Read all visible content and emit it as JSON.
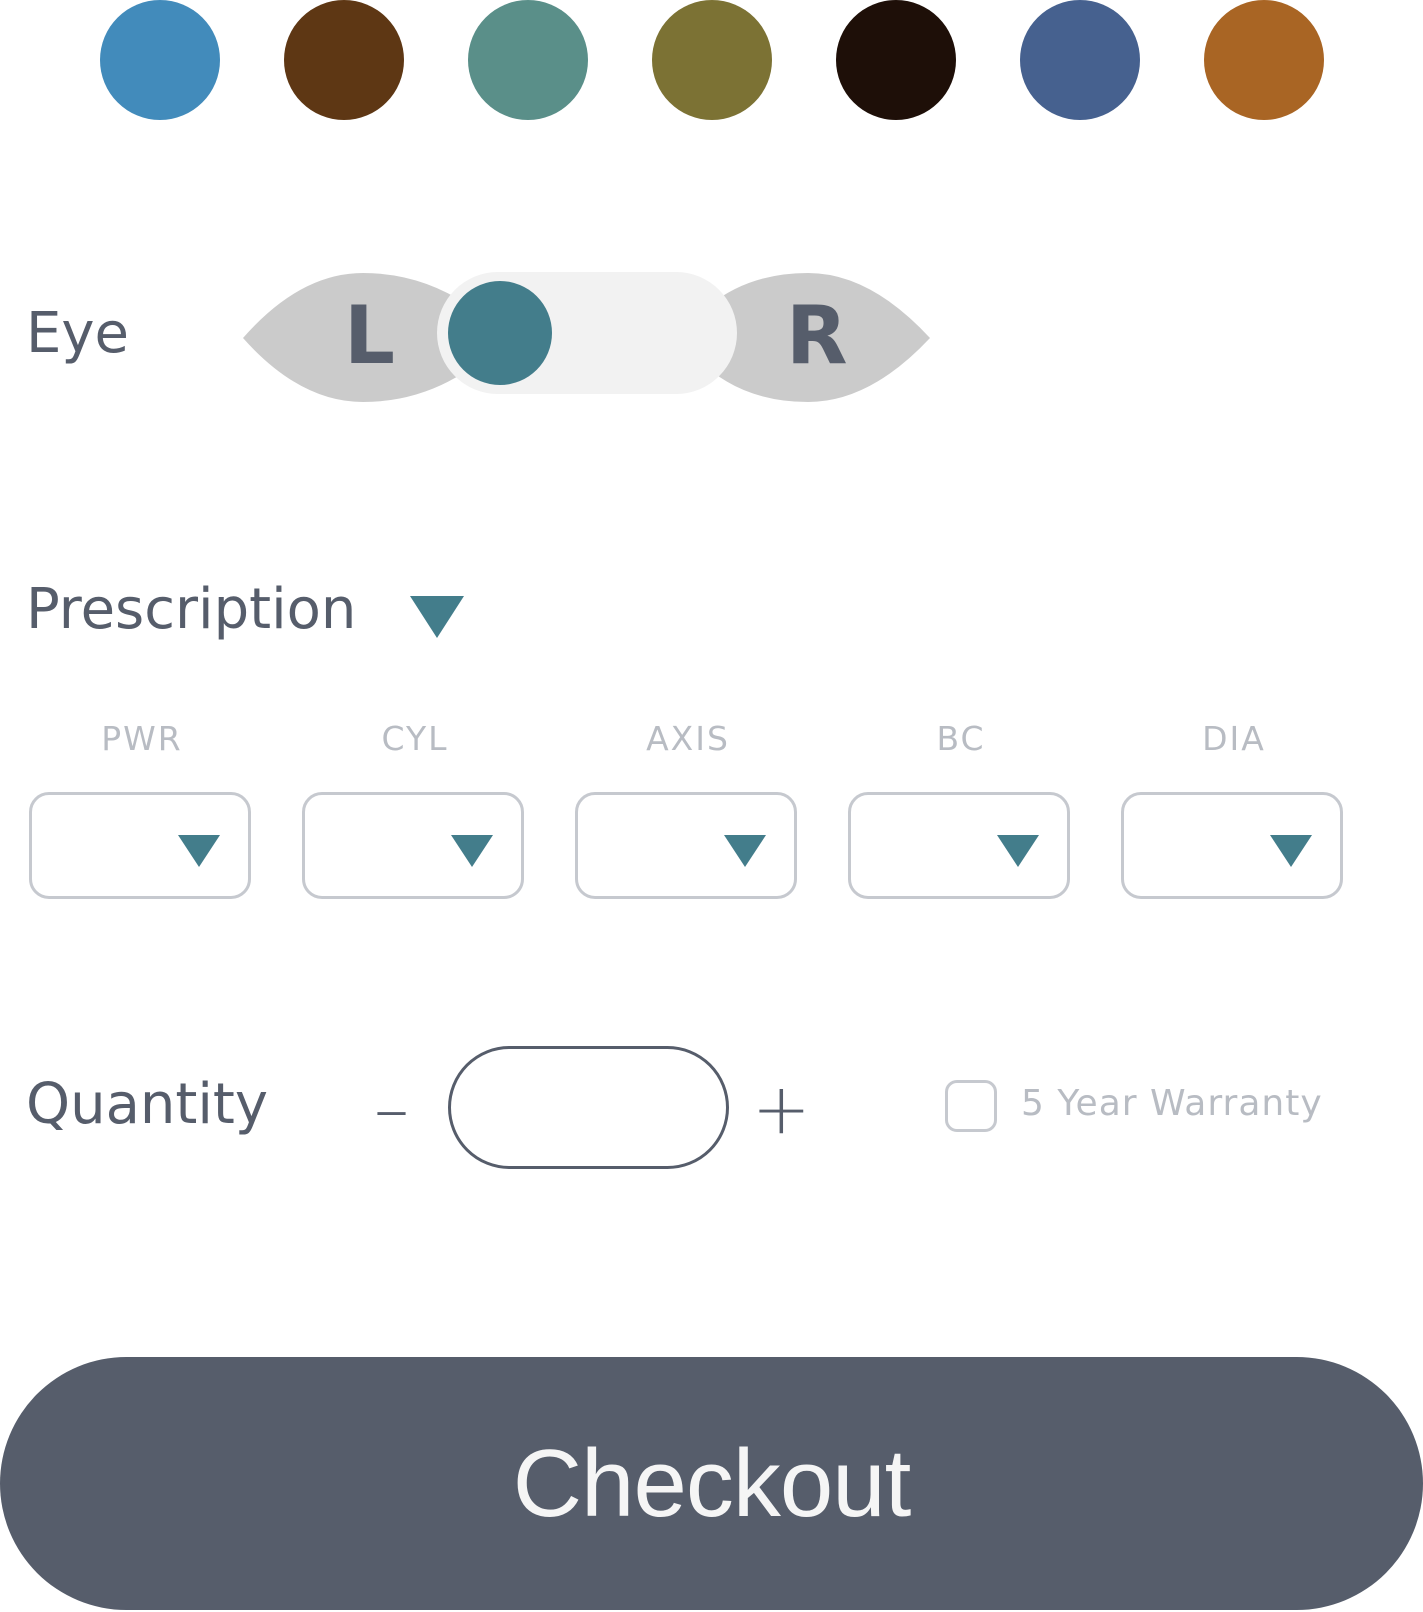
{
  "color_swatches": [
    {
      "name": "blue",
      "color": "#428bbb"
    },
    {
      "name": "brown",
      "color": "#5e3714"
    },
    {
      "name": "teal",
      "color": "#5a8f89"
    },
    {
      "name": "olive",
      "color": "#7c7234"
    },
    {
      "name": "black",
      "color": "#1e0f08"
    },
    {
      "name": "navy",
      "color": "#46618f"
    },
    {
      "name": "amber",
      "color": "#a96524"
    }
  ],
  "eye": {
    "label": "Eye",
    "left_letter": "L",
    "right_letter": "R",
    "selected": "L",
    "leaf_color": "#cbcbcb",
    "track_color": "#f2f2f2",
    "knob_color": "#437d8b"
  },
  "prescription": {
    "label": "Prescription",
    "caret_icon": "triangle-down-icon",
    "accent_color": "#437d8b",
    "fields": [
      {
        "key": "pwr",
        "label": "PWR",
        "value": ""
      },
      {
        "key": "cyl",
        "label": "CYL",
        "value": ""
      },
      {
        "key": "axis",
        "label": "AXIS",
        "value": ""
      },
      {
        "key": "bc",
        "label": "BC",
        "value": ""
      },
      {
        "key": "dia",
        "label": "DIA",
        "value": ""
      }
    ]
  },
  "quantity": {
    "label": "Quantity",
    "minus_symbol": "–",
    "plus_symbol": "+",
    "value": ""
  },
  "warranty": {
    "label": "5 Year Warranty",
    "checked": false
  },
  "checkout": {
    "label": "Checkout",
    "color": "#565d6b"
  }
}
